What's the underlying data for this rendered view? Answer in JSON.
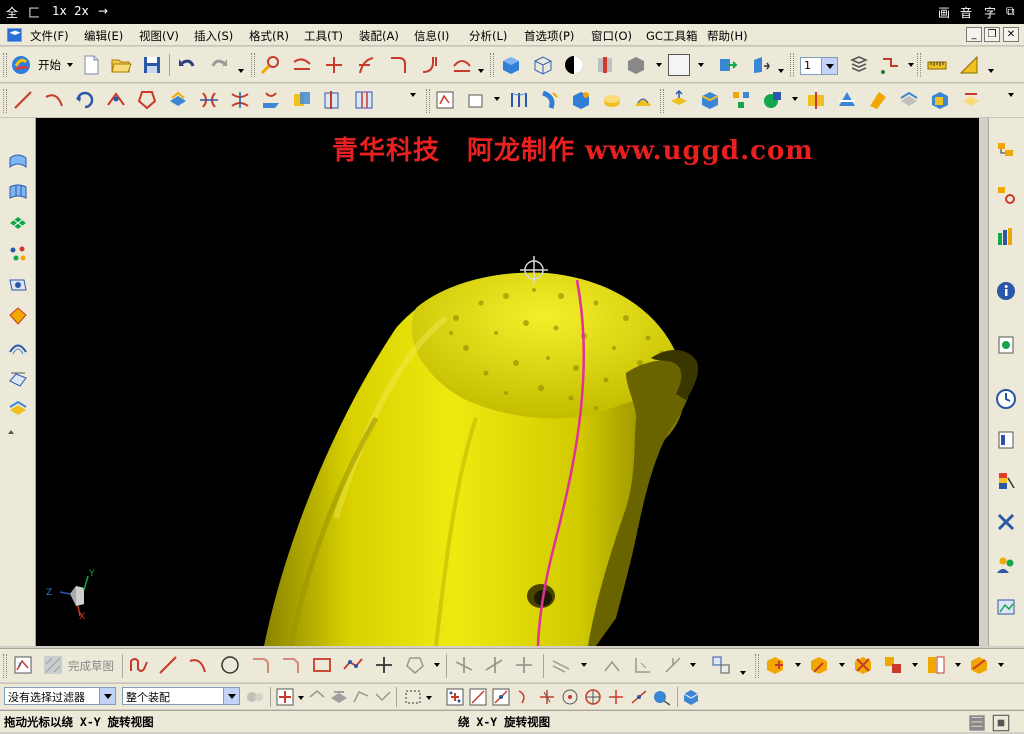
{
  "system_bar": {
    "left_items": [
      "全",
      "匚",
      "1x",
      "2x",
      "→"
    ],
    "right_items": [
      "画",
      "音",
      "字",
      "⧉"
    ]
  },
  "menu": {
    "items": [
      "文件(F)",
      "编辑(E)",
      "视图(V)",
      "插入(S)",
      "格式(R)",
      "工具(T)",
      "装配(A)",
      "信息(I)",
      "分析(L)",
      "首选项(P)",
      "窗口(O)",
      "GC工具箱",
      "帮助(H)"
    ],
    "window_buttons": [
      "_",
      "❐",
      "✕"
    ]
  },
  "toolbar": {
    "start_label": "开始",
    "layer_value": "1"
  },
  "viewport": {
    "watermark": "青华科技　阿龙制作 www.uggd.com",
    "background": "#000000",
    "model_color": "#e8e000",
    "curve_color": "#e0309a",
    "axes": {
      "x": "X",
      "y": "Y",
      "z": "Z"
    }
  },
  "sketch_toolbar": {
    "finish_sketch_label": "完成草图"
  },
  "selection": {
    "filter_value": "没有选择过滤器",
    "scope_value": "整个装配"
  },
  "status": {
    "left_text": "拖动光标以绕 X-Y 旋转视图",
    "center_text": "绕 X-Y 旋转视图"
  }
}
